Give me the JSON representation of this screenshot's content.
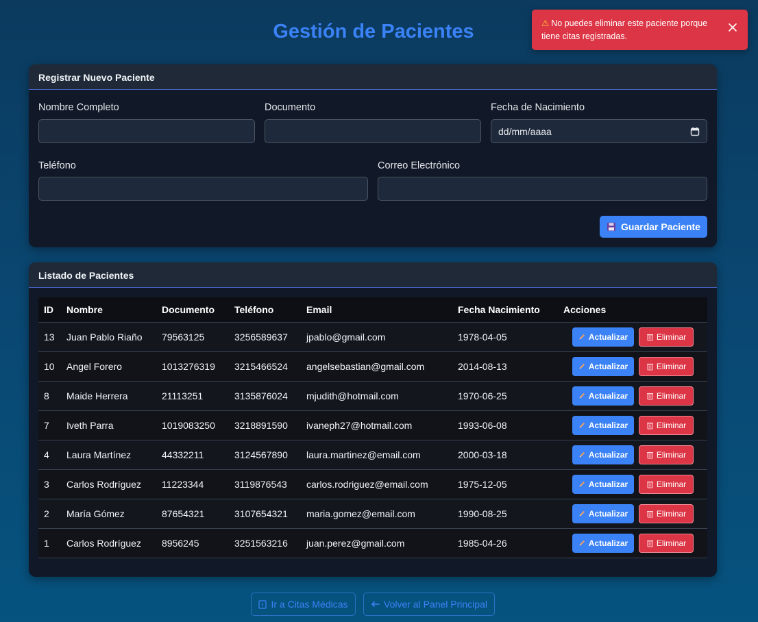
{
  "page": {
    "title": "Gestión de Pacientes"
  },
  "toast": {
    "icon": "warning-icon",
    "message": "No puedes eliminar este paciente porque tiene citas registradas."
  },
  "form": {
    "header": "Registrar Nuevo Paciente",
    "fields": {
      "nombre": {
        "label": "Nombre Completo",
        "value": ""
      },
      "documento": {
        "label": "Documento",
        "value": ""
      },
      "fecha": {
        "label": "Fecha de Nacimiento",
        "value": "dd/mm/aaaa"
      },
      "telefono": {
        "label": "Teléfono",
        "value": ""
      },
      "correo": {
        "label": "Correo Electrónico",
        "value": ""
      }
    },
    "save_label": "Guardar Paciente"
  },
  "list": {
    "header": "Listado de Pacientes",
    "columns": {
      "id": "ID",
      "nombre": "Nombre",
      "documento": "Documento",
      "telefono": "Teléfono",
      "email": "Email",
      "fecha": "Fecha Nacimiento",
      "acciones": "Acciones"
    },
    "update_label": "Actualizar",
    "delete_label": "Eliminar",
    "rows": [
      [
        "13",
        "Juan Pablo Riaño",
        "79563125",
        "3256589637",
        "jpablo@gmail.com",
        "1978-04-05"
      ],
      [
        "10",
        "Angel Forero",
        "1013276319",
        "3215466524",
        "angelsebastian@gmail.com",
        "2014-08-13"
      ],
      [
        "8",
        "Maide Herrera",
        "21113251",
        "3135876024",
        "mjudith@hotmail.com",
        "1970-06-25"
      ],
      [
        "7",
        "Iveth Parra",
        "1019083250",
        "3218891590",
        "ivaneph27@hotmail.com",
        "1993-06-08"
      ],
      [
        "4",
        "Laura Martínez",
        "44332211",
        "3124567890",
        "laura.martinez@email.com",
        "2000-03-18"
      ],
      [
        "3",
        "Carlos Rodríguez",
        "11223344",
        "3119876543",
        "carlos.rodriguez@email.com",
        "1975-12-05"
      ],
      [
        "2",
        "María Gómez",
        "87654321",
        "3107654321",
        "maria.gomez@email.com",
        "1990-08-25"
      ],
      [
        "1",
        "Carlos Rodríguez",
        "8956245",
        "3251563216",
        "juan.perez@gmail.com",
        "1985-04-26"
      ]
    ]
  },
  "footer": {
    "citas_label": "Ir a Citas Médicas",
    "volver_label": "Volver al Panel Principal"
  },
  "colors": {
    "accent": "#3b82f6",
    "danger": "#dc3545",
    "card_bg": "#111827"
  }
}
